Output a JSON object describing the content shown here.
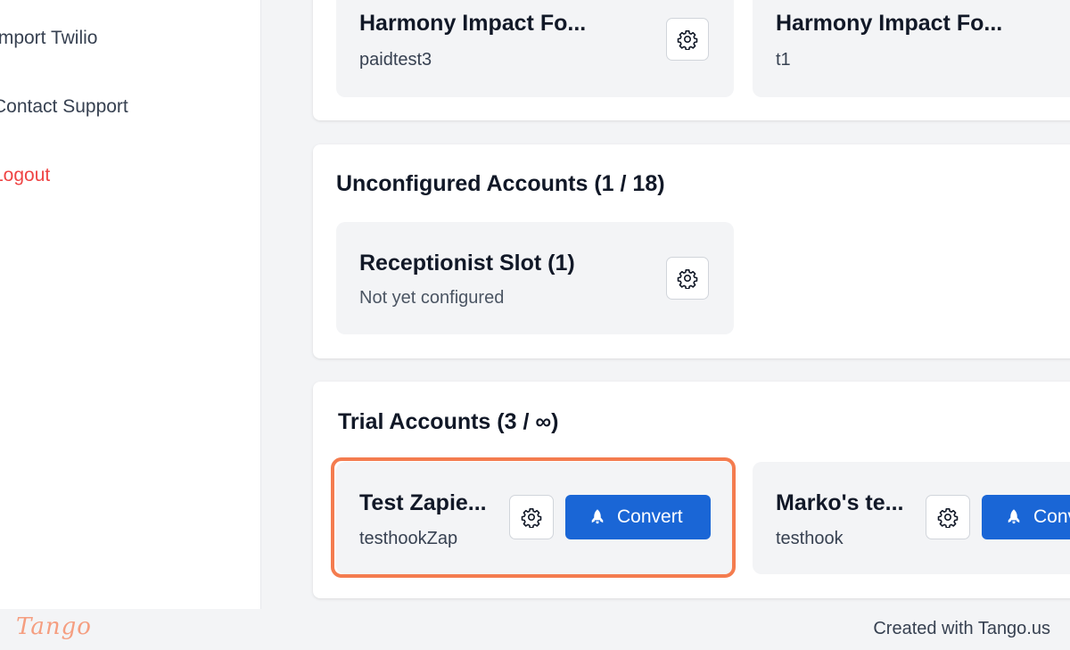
{
  "sidebar": {
    "items": [
      {
        "label": "Import Twilio"
      },
      {
        "label": "Contact Support"
      },
      {
        "label": "Logout"
      }
    ]
  },
  "paid_accounts": {
    "cards": [
      {
        "title": "Harmony Impact Fo...",
        "subtitle": "paidtest3",
        "icon": "gear-icon"
      },
      {
        "title": "Harmony Impact Fo...",
        "subtitle": "t1"
      }
    ]
  },
  "unconfigured": {
    "title": "Unconfigured Accounts (1 / 18)",
    "cards": [
      {
        "title": "Receptionist Slot (1)",
        "subtitle": "Not yet configured",
        "icon": "gear-icon"
      }
    ]
  },
  "trial": {
    "title": "Trial Accounts (3 / ∞)",
    "cards": [
      {
        "title": "Test Zapie...",
        "subtitle": "testhookZap",
        "convert_label": "Convert",
        "icon": "rocket-icon"
      },
      {
        "title": "Marko's te...",
        "subtitle": "testhook",
        "convert_label": "Convert"
      }
    ]
  },
  "footer": {
    "logo": "Tango",
    "text": "Created with Tango.us"
  },
  "colors": {
    "accent": "#1a66d6",
    "highlight": "#f47c4f",
    "logout": "#ef4444"
  }
}
